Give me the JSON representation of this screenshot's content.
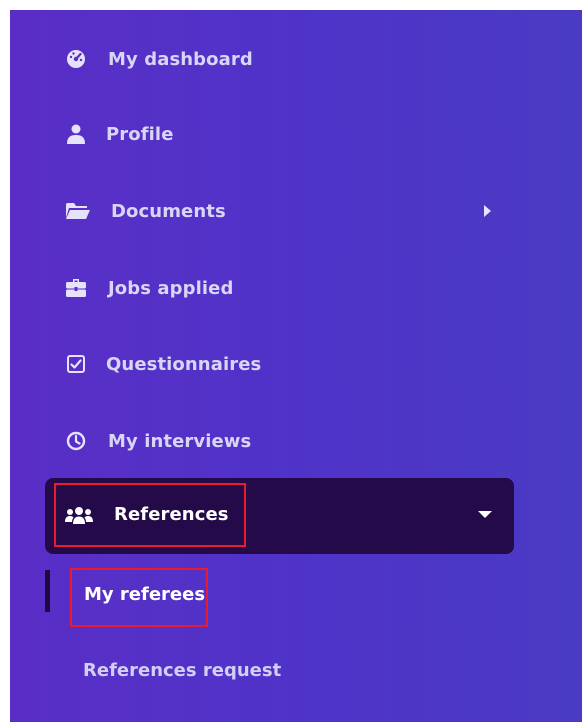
{
  "nav": {
    "items": [
      {
        "label": "My dashboard",
        "icon": "dashboard-gauge-icon"
      },
      {
        "label": "Profile",
        "icon": "user-icon"
      },
      {
        "label": "Documents",
        "icon": "folder-open-icon"
      },
      {
        "label": "Jobs applied",
        "icon": "briefcase-icon"
      },
      {
        "label": "Questionnaires",
        "icon": "checkbox-icon"
      },
      {
        "label": "My interviews",
        "icon": "clock-icon"
      }
    ],
    "active": {
      "label": "References",
      "icon": "users-group-icon"
    },
    "sub_items": [
      {
        "label": "My referees"
      },
      {
        "label": "References request"
      }
    ]
  },
  "colors": {
    "sidebar_gradient_start": "#5a2ec6",
    "sidebar_gradient_end": "#4a3bc4",
    "active_background": "#250a4a",
    "highlight_border": "#e81c2e"
  }
}
